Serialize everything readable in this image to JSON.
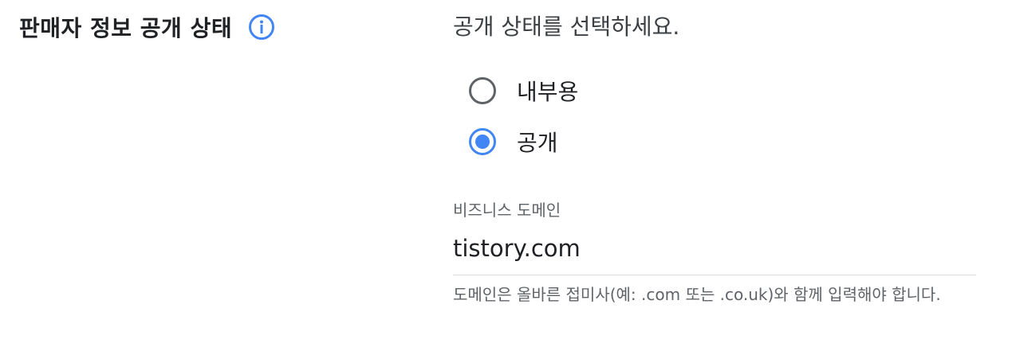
{
  "section": {
    "title": "판매자 정보 공개 상태",
    "info_icon": "info-icon"
  },
  "visibility": {
    "prompt": "공개 상태를 선택하세요.",
    "options": [
      {
        "label": "내부용",
        "selected": false
      },
      {
        "label": "공개",
        "selected": true
      }
    ]
  },
  "domain_field": {
    "label": "비즈니스 도메인",
    "value": "tistory.com",
    "helper": "도메인은 올바른 접미사(예: .com 또는 .co.uk)와 함께 입력해야 합니다."
  },
  "colors": {
    "accent": "#4285f4",
    "text": "#202124",
    "secondary_text": "#5f6368",
    "divider": "#dadce0"
  }
}
